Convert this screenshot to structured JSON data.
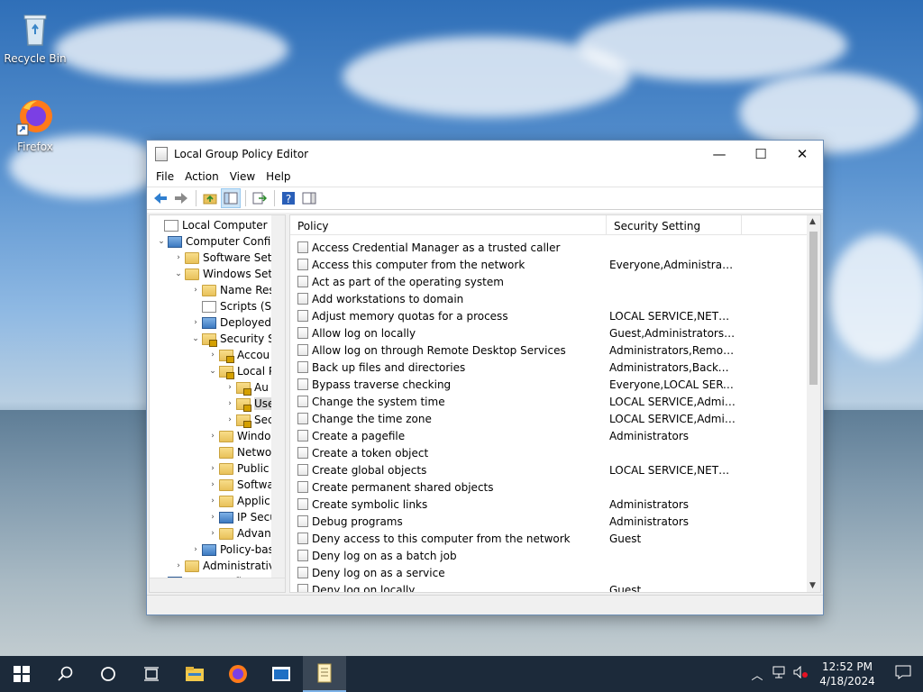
{
  "desktop": {
    "icons": [
      {
        "label": "Recycle Bin",
        "icon": "recycle-bin-icon"
      },
      {
        "label": "Firefox",
        "icon": "firefox-icon"
      }
    ]
  },
  "window": {
    "title": "Local Group Policy Editor",
    "controls": {
      "minimize": "—",
      "maximize": "☐",
      "close": "✕"
    },
    "menu": [
      "File",
      "Action",
      "View",
      "Help"
    ],
    "toolbar": [
      "back-icon",
      "forward-icon",
      "up-folder-icon",
      "show-hide-tree-icon",
      "export-list-icon",
      "help-icon",
      "show-hide-action-pane-icon"
    ]
  },
  "tree": {
    "items": [
      {
        "label": "Local Computer Polic",
        "chev": "",
        "icon": "doc"
      },
      {
        "label": "Computer Config",
        "chev": "⌄",
        "icon": "pc"
      },
      {
        "label": "Software Setti",
        "chev": "›",
        "icon": "folder"
      },
      {
        "label": "Windows Sett",
        "chev": "⌄",
        "icon": "folder"
      },
      {
        "label": "Name Res",
        "chev": "›",
        "icon": "folder"
      },
      {
        "label": "Scripts (Sta",
        "chev": "",
        "icon": "doc"
      },
      {
        "label": "Deployed",
        "chev": "›",
        "icon": "pc"
      },
      {
        "label": "Security Se",
        "chev": "⌄",
        "icon": "lock"
      },
      {
        "label": "Accou",
        "chev": "›",
        "icon": "lock"
      },
      {
        "label": "Local P",
        "chev": "⌄",
        "icon": "lock"
      },
      {
        "label": "Au",
        "chev": "›",
        "icon": "lock"
      },
      {
        "label": "Use",
        "chev": "›",
        "icon": "lock",
        "selected": true
      },
      {
        "label": "Sec",
        "chev": "›",
        "icon": "lock"
      },
      {
        "label": "Windo",
        "chev": "›",
        "icon": "folder"
      },
      {
        "label": "Netwo",
        "chev": "",
        "icon": "folder"
      },
      {
        "label": "Public",
        "chev": "›",
        "icon": "folder"
      },
      {
        "label": "Softwa",
        "chev": "›",
        "icon": "folder"
      },
      {
        "label": "Applic",
        "chev": "›",
        "icon": "folder"
      },
      {
        "label": "IP Secu",
        "chev": "›",
        "icon": "pc"
      },
      {
        "label": "Advan",
        "chev": "›",
        "icon": "folder"
      },
      {
        "label": "Policy-bas",
        "chev": "›",
        "icon": "chart"
      },
      {
        "label": "Administrative",
        "chev": "›",
        "icon": "folder"
      },
      {
        "label": "User Configuration",
        "chev": "›",
        "icon": "pc"
      }
    ]
  },
  "list": {
    "headers": {
      "policy": "Policy",
      "setting": "Security Setting"
    },
    "rows": [
      {
        "policy": "Access Credential Manager as a trusted caller",
        "setting": ""
      },
      {
        "policy": "Access this computer from the network",
        "setting": "Everyone,Administrators..."
      },
      {
        "policy": "Act as part of the operating system",
        "setting": ""
      },
      {
        "policy": "Add workstations to domain",
        "setting": ""
      },
      {
        "policy": "Adjust memory quotas for a process",
        "setting": "LOCAL SERVICE,NETWO..."
      },
      {
        "policy": "Allow log on locally",
        "setting": "Guest,Administrators,Us..."
      },
      {
        "policy": "Allow log on through Remote Desktop Services",
        "setting": "Administrators,Remote ..."
      },
      {
        "policy": "Back up files and directories",
        "setting": "Administrators,Backup ..."
      },
      {
        "policy": "Bypass traverse checking",
        "setting": "Everyone,LOCAL SERVIC..."
      },
      {
        "policy": "Change the system time",
        "setting": "LOCAL SERVICE,Admini..."
      },
      {
        "policy": "Change the time zone",
        "setting": "LOCAL SERVICE,Admini..."
      },
      {
        "policy": "Create a pagefile",
        "setting": "Administrators"
      },
      {
        "policy": "Create a token object",
        "setting": ""
      },
      {
        "policy": "Create global objects",
        "setting": "LOCAL SERVICE,NETWO..."
      },
      {
        "policy": "Create permanent shared objects",
        "setting": ""
      },
      {
        "policy": "Create symbolic links",
        "setting": "Administrators"
      },
      {
        "policy": "Debug programs",
        "setting": "Administrators"
      },
      {
        "policy": "Deny access to this computer from the network",
        "setting": "Guest"
      },
      {
        "policy": "Deny log on as a batch job",
        "setting": ""
      },
      {
        "policy": "Deny log on as a service",
        "setting": ""
      },
      {
        "policy": "Deny log on locally",
        "setting": "Guest"
      }
    ]
  },
  "taskbar": {
    "items": [
      "start-icon",
      "search-icon",
      "cortana-icon",
      "task-view-icon",
      "file-explorer-icon",
      "firefox-icon",
      "remote-desktop-icon",
      "group-policy-editor-icon"
    ],
    "time": "12:52 PM",
    "date": "4/18/2024"
  }
}
